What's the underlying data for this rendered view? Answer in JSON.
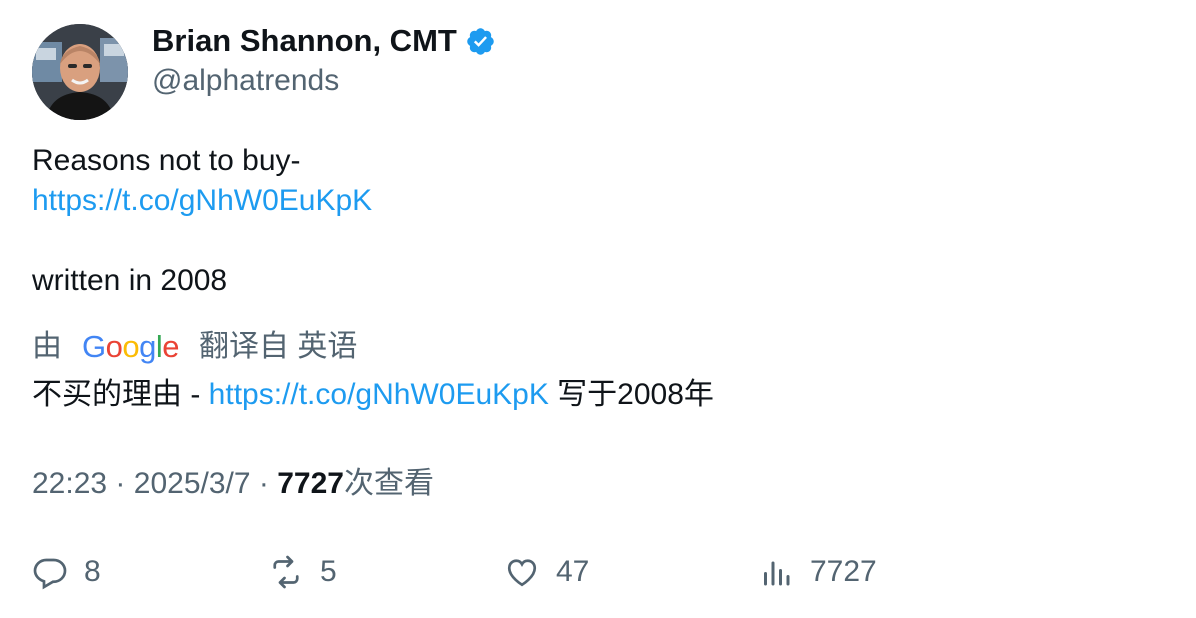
{
  "author": {
    "display_name": "Brian Shannon, CMT",
    "handle": "@alphatrends",
    "verified": true,
    "avatar_icon": "profile-photo"
  },
  "tweet": {
    "line1": "Reasons not to buy-",
    "link": "https://t.co/gNhW0EuKpK",
    "line3": "written in 2008"
  },
  "translation": {
    "prefix": "由",
    "provider": "Google",
    "suffix": "翻译自 英语",
    "text_before": "不买的理由 - ",
    "link": "https://t.co/gNhW0EuKpK",
    "text_after": " 写于2008年"
  },
  "meta": {
    "time": "22:23",
    "separator": "·",
    "date": "2025/3/7",
    "views_count": "7727",
    "views_label": "次查看"
  },
  "actions": {
    "replies": "8",
    "retweets": "5",
    "likes": "47",
    "views": "7727"
  },
  "colors": {
    "text": "#0f1419",
    "secondary": "#536471",
    "link": "#1d9bf0",
    "verified": "#1d9bf0"
  }
}
